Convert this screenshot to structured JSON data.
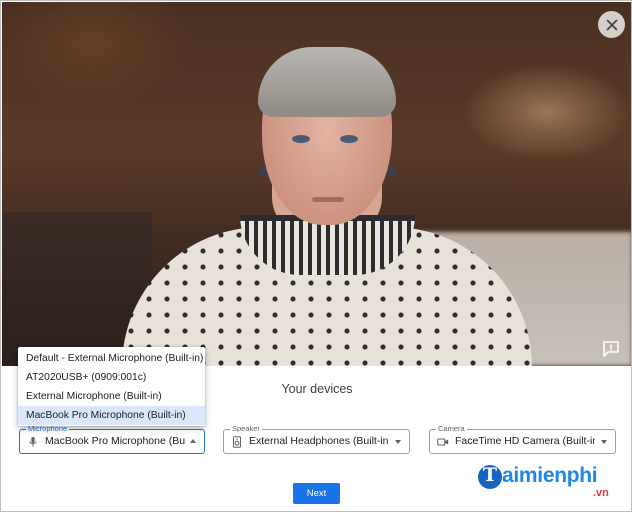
{
  "preview": {
    "close_icon": "close-icon",
    "feedback_icon": "feedback-icon"
  },
  "devices": {
    "title": "Your devices",
    "microphone": {
      "label": "Microphone",
      "value": "MacBook Pro Microphone (Bu...",
      "icon": "microphone-icon",
      "options": [
        "Default - External Microphone (Built-in)",
        "AT2020USB+ (0909:001c)",
        "External Microphone (Built-in)",
        "MacBook Pro Microphone (Built-in)"
      ],
      "selected_index": 3
    },
    "speaker": {
      "label": "Speaker",
      "value": "External Headphones (Built-in)",
      "icon": "speaker-icon"
    },
    "camera": {
      "label": "Camera",
      "value": "FaceTime HD Camera (Built-in...",
      "icon": "camera-icon"
    },
    "next_label": "Next"
  },
  "watermark": {
    "brand": "aimienphi",
    "letter": "T",
    "tld": ".vn"
  },
  "colors": {
    "accent": "#1a73e8",
    "selected_bg": "#dce6fb",
    "brand_blue": "#1e88e5",
    "brand_red": "#e53935"
  }
}
